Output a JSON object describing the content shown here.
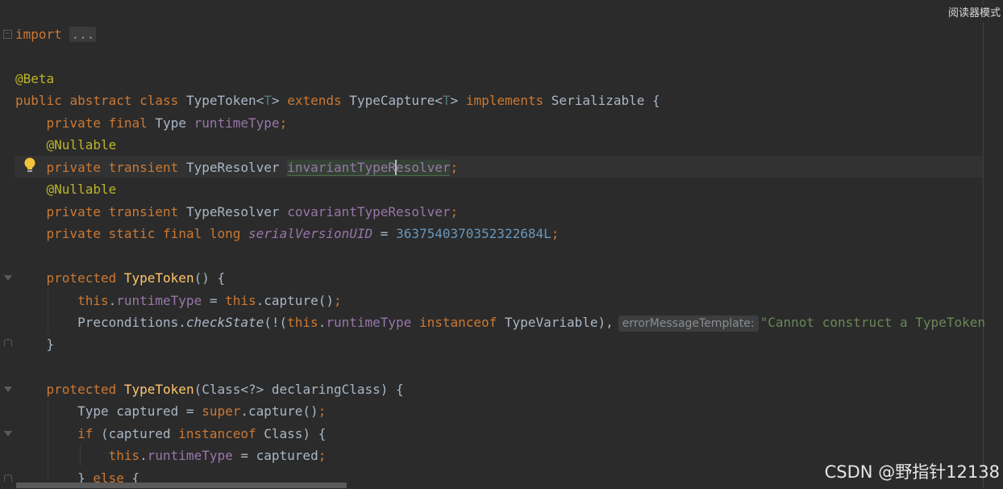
{
  "reader_mode": "阅读器模式",
  "watermark": "CSDN @野指针12138",
  "code": {
    "l_import": {
      "kw": "import",
      "fold": "..."
    },
    "l_beta": "@Beta",
    "l_class": {
      "public": "public",
      "abstract": "abstract",
      "class": "class",
      "name": "TypeToken",
      "lt": "<",
      "T": "T",
      "gt": ">",
      "extends": "extends",
      "parent": "TypeCapture",
      "implements": "implements",
      "iface": "Serializable",
      "brace": "{"
    },
    "l_runtime": {
      "private": "private",
      "final": "final",
      "type": "Type",
      "field": "runtimeType",
      "semi": ";"
    },
    "l_nullable1": "@Nullable",
    "l_invariant": {
      "private": "private",
      "transient": "transient",
      "type": "TypeResolver",
      "field_a": "invariantTypeR",
      "field_b": "esolver",
      "semi": ";"
    },
    "l_nullable2": "@Nullable",
    "l_covariant": {
      "private": "private",
      "transient": "transient",
      "type": "TypeResolver",
      "field": "covariantTypeResolver",
      "semi": ";"
    },
    "l_serial": {
      "private": "private",
      "static": "static",
      "final": "final",
      "long": "long",
      "field": "serialVersionUID",
      "eq": "=",
      "value": "3637540370352322684L",
      "semi": ";"
    },
    "l_ctor1": {
      "protected": "protected",
      "name": "TypeToken",
      "rest": "() {"
    },
    "l_assign1": {
      "this": "this",
      "dot": ".",
      "field": "runtimeType",
      "eq": " = ",
      "this2": "this",
      "call": ".capture()",
      "semi": ";"
    },
    "l_precond": {
      "cls": "Preconditions.",
      "method": "checkState",
      "open": "(!(",
      "this": "this",
      "dot": ".",
      "field": "runtimeType",
      "instanceof": "instanceof",
      "type": "TypeVariable),",
      "hint": "errorMessageTemplate:",
      "str": "\"Cannot construct a TypeToken"
    },
    "l_close1": "}",
    "l_ctor2": {
      "protected": "protected",
      "name": "TypeToken",
      "rest": "(Class<?> declaringClass) {"
    },
    "l_captured": {
      "decl": "Type captured = ",
      "super": "super",
      "call": ".capture()",
      "semi": ";"
    },
    "l_if": {
      "if": "if",
      "open": " (captured ",
      "instanceof": "instanceof",
      "rest": " Class) {"
    },
    "l_assign2": {
      "this": "this",
      "dot": ".",
      "field": "runtimeType",
      "rest": " = captured",
      "semi": ";"
    },
    "l_else": {
      "brace": "} ",
      "else": "else",
      "open": " {"
    }
  }
}
